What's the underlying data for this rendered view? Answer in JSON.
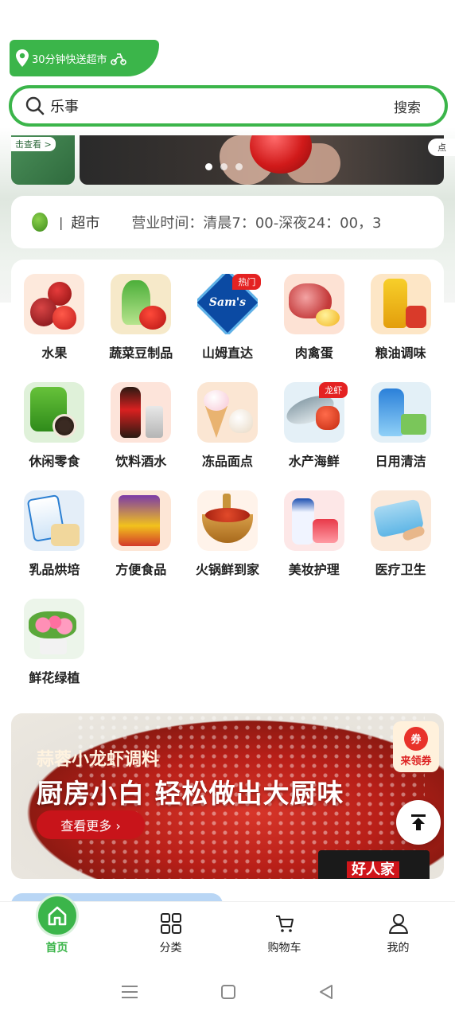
{
  "header": {
    "delivery_tag": "30分钟快送超市",
    "search_query": "乐事",
    "search_button": "搜索"
  },
  "banner": {
    "left_tag": "击查看 >",
    "right_tag": "点",
    "dots": 3,
    "active_dot": 0
  },
  "store": {
    "separator": "|",
    "name": "超市",
    "hours": "营业时间：清晨7：00-深夜24：00，3"
  },
  "categories": [
    {
      "label": "水果",
      "icon": "fruit-icon"
    },
    {
      "label": "蔬菜豆制品",
      "icon": "vegetable-icon"
    },
    {
      "label": "山姆直达",
      "icon": "sams-club-icon",
      "badge": "热门"
    },
    {
      "label": "肉禽蛋",
      "icon": "meat-icon"
    },
    {
      "label": "粮油调味",
      "icon": "grain-oil-icon"
    },
    {
      "label": "休闲零食",
      "icon": "snack-icon"
    },
    {
      "label": "饮料酒水",
      "icon": "drink-icon"
    },
    {
      "label": "冻品面点",
      "icon": "frozen-food-icon"
    },
    {
      "label": "水产海鲜",
      "icon": "seafood-icon",
      "badge": "龙虾"
    },
    {
      "label": "日用清洁",
      "icon": "daily-cleaning-icon"
    },
    {
      "label": "乳品烘培",
      "icon": "dairy-icon"
    },
    {
      "label": "方便食品",
      "icon": "instant-food-icon"
    },
    {
      "label": "火锅鲜到家",
      "icon": "hotpot-icon"
    },
    {
      "label": "美妆护理",
      "icon": "beauty-icon"
    },
    {
      "label": "医疗卫生",
      "icon": "medical-icon"
    },
    {
      "label": "鲜花绿植",
      "icon": "flower-icon"
    }
  ],
  "sams_logo_text": "Sam's",
  "promo": {
    "subtitle": "蒜蓉小龙虾调料",
    "title": "厨房小白 轻松做出大厨味",
    "more_button": "查看更多 ›",
    "coupon_mark": "券",
    "coupon_label": "来领券",
    "brand": "好人家"
  },
  "tabbar": [
    {
      "label": "首页",
      "icon": "home-icon",
      "active": true
    },
    {
      "label": "分类",
      "icon": "grid-icon",
      "active": false
    },
    {
      "label": "购物车",
      "icon": "cart-icon",
      "active": false
    },
    {
      "label": "我的",
      "icon": "user-icon",
      "active": false
    }
  ],
  "colors": {
    "brand_green": "#3bb54a",
    "badge_red": "#e42222",
    "promo_red": "#c8141a"
  }
}
